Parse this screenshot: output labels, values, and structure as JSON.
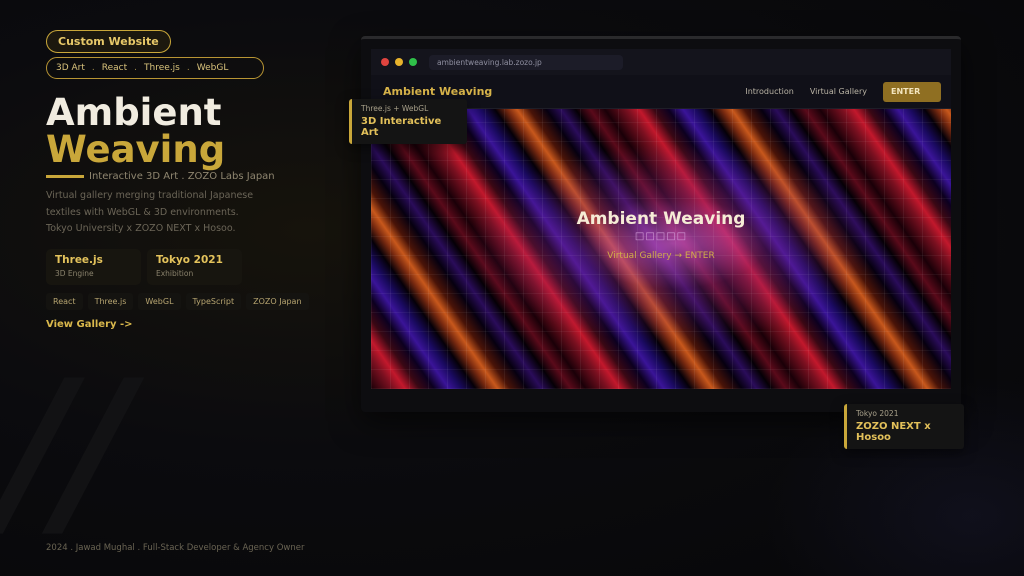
{
  "left": {
    "tag": "Custom Website",
    "stack": [
      "3D Art",
      "React",
      "Three.js",
      "WebGL"
    ],
    "stack_sep": ".",
    "title_line1": "Ambient",
    "title_line2": "Weaving",
    "subtitle": "Interactive 3D Art  .  ZOZO Labs Japan",
    "description": [
      "Virtual gallery merging traditional Japanese",
      "textiles with WebGL & 3D environments.",
      "Tokyo University x ZOZO NEXT x Hosoo."
    ],
    "stats": [
      {
        "value": "Three.js",
        "label": "3D Engine"
      },
      {
        "value": "Tokyo 2021",
        "label": "Exhibition"
      }
    ],
    "chips": [
      "React",
      "Three.js",
      "WebGL",
      "TypeScript",
      "ZOZO Japan"
    ],
    "view_link": "View Gallery  ->"
  },
  "footer": "2024  .  Jawad Mughal  .  Full-Stack Developer & Agency Owner",
  "browser": {
    "url": "ambientweaving.lab.zozo.jp",
    "site_logo": "Ambient Weaving",
    "nav": [
      "Introduction",
      "Virtual Gallery"
    ],
    "enter": "ENTER",
    "hero_title": "Ambient Weaving",
    "hero_jp": "□□□□□",
    "hero_cta": "Virtual Gallery  →  ENTER"
  },
  "badges": [
    {
      "key": "Three.js + WebGL",
      "value": "3D Interactive Art"
    },
    {
      "key": "Tokyo 2021",
      "value": "ZOZO NEXT x Hosoo"
    }
  ],
  "colors": {
    "accent": "#c9a73a",
    "background": "#0b0b0e"
  }
}
